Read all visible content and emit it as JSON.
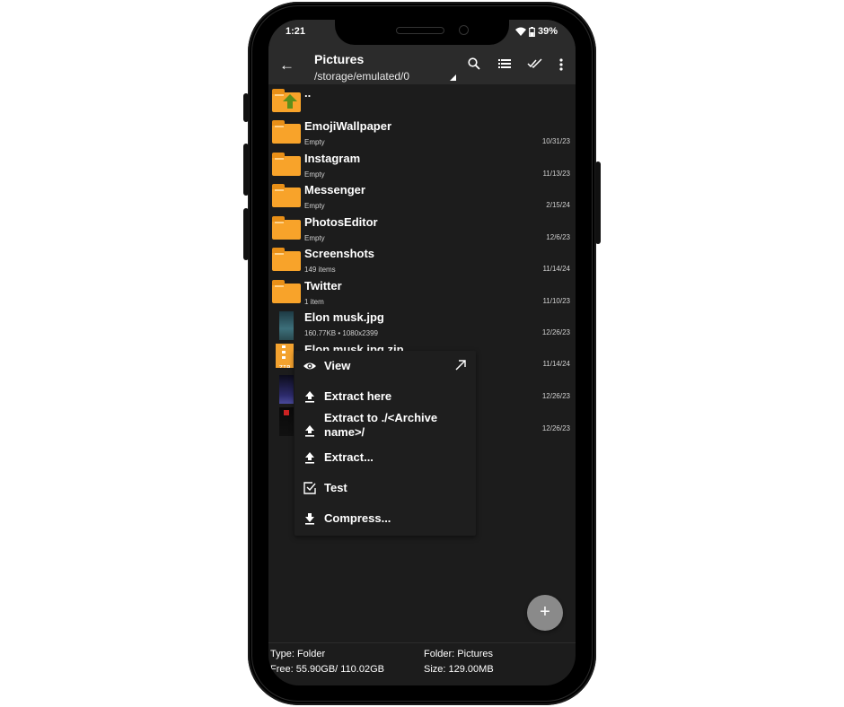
{
  "status_bar": {
    "time": "1:21",
    "battery": "39%",
    "wifi_icon": "wifi-icon",
    "battery_icon": "battery-icon"
  },
  "app_bar": {
    "title": "Pictures",
    "path": "/storage/emulated/0",
    "actions": [
      "search-icon",
      "list-view-icon",
      "select-all-icon",
      "more-vert-icon"
    ]
  },
  "files": [
    {
      "type": "parent",
      "name": "..",
      "sub": "",
      "date": ""
    },
    {
      "type": "folder",
      "name": "EmojiWallpaper",
      "sub": "Empty",
      "date": "10/31/23"
    },
    {
      "type": "folder",
      "name": "Instagram",
      "sub": "Empty",
      "date": "11/13/23"
    },
    {
      "type": "folder",
      "name": "Messenger",
      "sub": "Empty",
      "date": "2/15/24"
    },
    {
      "type": "folder",
      "name": "PhotosEditor",
      "sub": "Empty",
      "date": "12/6/23"
    },
    {
      "type": "folder",
      "name": "Screenshots",
      "sub": "149 items",
      "date": "11/14/24"
    },
    {
      "type": "folder",
      "name": "Twitter",
      "sub": "1 item",
      "date": "11/10/23"
    },
    {
      "type": "image",
      "name": "Elon musk.jpg",
      "sub": "160.77KB   • 1080x2399",
      "date": "12/26/23"
    },
    {
      "type": "zip",
      "name": "Elon musk.jpg.zip",
      "sub": "",
      "date": "11/14/24"
    },
    {
      "type": "image",
      "name": "",
      "sub": "",
      "date": "12/26/23"
    },
    {
      "type": "image",
      "name": "",
      "sub": "",
      "date": "12/26/23"
    }
  ],
  "context_menu": {
    "items": [
      {
        "label": "View",
        "icon": "eye-icon",
        "trailing": "open-external-icon"
      },
      {
        "label": "Extract here",
        "icon": "extract-icon"
      },
      {
        "label": "Extract to ./<Archive name>/",
        "icon": "extract-icon"
      },
      {
        "label": "Extract...",
        "icon": "extract-icon"
      },
      {
        "label": "Test",
        "icon": "checkbox-icon"
      },
      {
        "label": "Compress...",
        "icon": "compress-icon"
      }
    ]
  },
  "fab": {
    "label": "+"
  },
  "footer": {
    "type": "Type: Folder",
    "free": "Free: 55.90GB/ 110.02GB",
    "folder": "Folder: Pictures",
    "size": "Size: 129.00MB"
  },
  "colors": {
    "folder": "#f8a32a",
    "app_bar": "#2b2b2b",
    "background": "#1c1c1c",
    "fab": "#8a8a8a"
  }
}
